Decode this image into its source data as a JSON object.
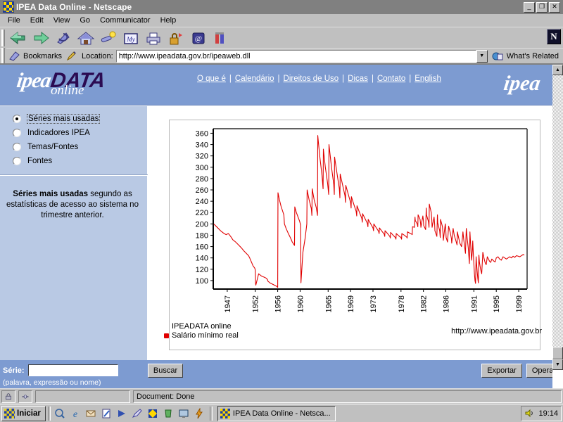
{
  "window": {
    "title": "IPEA Data Online - Netscape",
    "icon": "netscape-icon",
    "minimize_label": "_",
    "restore_label": "❐",
    "close_label": "✕"
  },
  "menubar": {
    "items": [
      {
        "label": "File"
      },
      {
        "label": "Edit"
      },
      {
        "label": "View"
      },
      {
        "label": "Go"
      },
      {
        "label": "Communicator"
      },
      {
        "label": "Help"
      }
    ]
  },
  "toolbar": {
    "buttons": [
      {
        "name": "back-icon",
        "glyph": "◀"
      },
      {
        "name": "forward-icon",
        "glyph": "▶"
      },
      {
        "name": "reload-icon",
        "glyph": "↻"
      },
      {
        "name": "home-icon",
        "glyph": "⌂"
      },
      {
        "name": "search-icon",
        "glyph": "⚲"
      },
      {
        "name": "my-netscape-icon",
        "glyph": "My"
      },
      {
        "name": "print-icon",
        "glyph": "⎙"
      },
      {
        "name": "security-icon",
        "glyph": "⚿"
      },
      {
        "name": "shop-icon",
        "glyph": "@"
      },
      {
        "name": "stop-icon",
        "glyph": "⬚"
      }
    ]
  },
  "locationbar": {
    "bookmarks_label": "Bookmarks",
    "location_label": "Location:",
    "url": "http://www.ipeadata.gov.br/ipeaweb.dll",
    "dropdown_glyph": "▼",
    "whats_related_label": "What's Related",
    "netscape_badge": "N"
  },
  "banner": {
    "logo_ipea": "ipea",
    "logo_data": "DATA",
    "logo_online": "online",
    "logo_right": "ipea",
    "nav_links": [
      {
        "label": "O que é"
      },
      {
        "label": "Calendário"
      },
      {
        "label": "Direitos de Uso"
      },
      {
        "label": "Dicas"
      },
      {
        "label": "Contato"
      },
      {
        "label": "English"
      }
    ],
    "nav_separator": "|"
  },
  "sidebar": {
    "options": [
      {
        "label": "Séries mais usadas",
        "selected": true
      },
      {
        "label": "Indicadores IPEA",
        "selected": false
      },
      {
        "label": "Temas/Fontes",
        "selected": false
      },
      {
        "label": "Fontes",
        "selected": false
      }
    ],
    "description_bold": "Séries mais usadas",
    "description_rest": " segundo as estatísticas de acesso ao sistema no trimestre anterior."
  },
  "chart_legend": {
    "source": "IPEADATA online",
    "series_label": "Salário mínimo real",
    "url": "http://www.ipeadata.gov.br"
  },
  "form": {
    "serie_label": "Série:",
    "serie_value": "",
    "serie_placeholder": "",
    "serie_hint": "(palavra, expressão ou nome)",
    "buscar_label": "Buscar",
    "exportar_label": "Exportar",
    "operar_label": "Operar"
  },
  "scrollbar": {
    "up_glyph": "▲",
    "down_glyph": "▼"
  },
  "statusbar": {
    "security_icon": "⚿",
    "connection_icon": "⧉",
    "status_text": "Document: Done"
  },
  "taskbar": {
    "start_label": "Iniciar",
    "quick_icons": [
      {
        "name": "show-desktop-icon",
        "glyph": "Ὕ4"
      },
      {
        "name": "internet-explorer-icon",
        "glyph": "e"
      },
      {
        "name": "mail-icon",
        "glyph": "✉"
      },
      {
        "name": "notepad-icon",
        "glyph": "✎"
      },
      {
        "name": "winamp-icon",
        "glyph": "▶"
      },
      {
        "name": "paint-icon",
        "glyph": "✏"
      },
      {
        "name": "netscape-quick-icon",
        "glyph": "✦"
      },
      {
        "name": "recycle-icon",
        "glyph": "♻"
      },
      {
        "name": "monitor-icon",
        "glyph": "▣"
      },
      {
        "name": "flash-icon",
        "glyph": "⚡"
      }
    ],
    "task_title": "IPEA Data Online - Netsca...",
    "tray_volume_icon": "ὐA",
    "clock": "19:14"
  },
  "colors": {
    "banner_blue": "#7d9bd1",
    "sidebar_blue": "#b9c9e4",
    "series_red": "#e00000",
    "logo_purple": "#2b0b52",
    "chrome_gray": "#c0c0c0",
    "titlebar_gray": "#808080"
  },
  "chart_data": {
    "type": "line",
    "title": "",
    "xlabel": "",
    "ylabel": "",
    "series_name": "Salário mínimo real",
    "color": "#e00000",
    "grid": false,
    "legend_position": "bottom-left",
    "xlim": [
      1944.5,
      2000.5
    ],
    "ylim": [
      85,
      368
    ],
    "ytick_values": [
      100,
      120,
      140,
      160,
      180,
      200,
      220,
      240,
      260,
      280,
      300,
      320,
      340,
      360
    ],
    "xtick_labels": [
      "1947",
      "1952",
      "1956",
      "1960",
      "1965",
      "1969",
      "1973",
      "1978",
      "1982",
      "1986",
      "1991",
      "1995",
      "1999"
    ],
    "xtick_values": [
      1947,
      1952,
      1956,
      1960,
      1965,
      1969,
      1973,
      1978,
      1982,
      1986,
      1991,
      1995,
      1999
    ],
    "x": [
      1944.6,
      1945.2,
      1945.8,
      1946.3,
      1946.8,
      1947.2,
      1947.6,
      1948.0,
      1948.5,
      1949.0,
      1949.5,
      1950.0,
      1950.4,
      1950.8,
      1951.0,
      1951.3,
      1951.6,
      1951.9,
      1952.0,
      1952.05,
      1952.1,
      1952.6,
      1953.1,
      1953.6,
      1954.0,
      1954.2,
      1954.25,
      1954.6,
      1955.0,
      1955.4,
      1955.8,
      1956.0,
      1956.05,
      1956.3,
      1956.6,
      1956.9,
      1957.1,
      1957.2,
      1957.5,
      1957.9,
      1958.3,
      1958.6,
      1959.0,
      1959.05,
      1959.3,
      1959.6,
      1959.9,
      1960.1,
      1960.15,
      1960.5,
      1960.9,
      1961.2,
      1961.25,
      1961.6,
      1962.0,
      1962.1,
      1962.15,
      1962.5,
      1962.9,
      1963.1,
      1963.15,
      1963.5,
      1963.9,
      1964.1,
      1964.15,
      1964.5,
      1964.9,
      1965.1,
      1965.15,
      1965.6,
      1966.0,
      1966.1,
      1966.15,
      1966.6,
      1967.0,
      1967.1,
      1967.15,
      1967.6,
      1968.0,
      1968.1,
      1968.15,
      1968.6,
      1969.0,
      1969.1,
      1969.15,
      1969.6,
      1970.0,
      1970.1,
      1970.15,
      1970.6,
      1971.0,
      1971.1,
      1971.15,
      1971.6,
      1972.0,
      1972.1,
      1972.15,
      1972.6,
      1973.0,
      1973.1,
      1973.15,
      1973.6,
      1974.0,
      1974.1,
      1974.15,
      1974.6,
      1975.0,
      1975.1,
      1975.15,
      1975.6,
      1976.0,
      1976.1,
      1976.15,
      1976.6,
      1977.0,
      1977.1,
      1977.15,
      1977.6,
      1978.0,
      1978.1,
      1978.15,
      1978.6,
      1979.0,
      1979.1,
      1979.15,
      1979.5,
      1979.9,
      1980.0,
      1980.05,
      1980.4,
      1980.5,
      1980.55,
      1980.9,
      1981.0,
      1981.05,
      1981.4,
      1981.5,
      1981.55,
      1981.9,
      1982.0,
      1982.05,
      1982.4,
      1982.5,
      1982.55,
      1982.9,
      1983.0,
      1983.05,
      1983.4,
      1983.5,
      1983.55,
      1983.9,
      1984.0,
      1984.05,
      1984.4,
      1984.5,
      1984.55,
      1984.9,
      1985.0,
      1985.05,
      1985.4,
      1985.5,
      1985.55,
      1985.9,
      1986.0,
      1986.05,
      1986.3,
      1986.5,
      1986.8,
      1987.0,
      1987.05,
      1987.3,
      1987.5,
      1987.8,
      1988.0,
      1988.05,
      1988.3,
      1988.5,
      1988.8,
      1989.0,
      1989.05,
      1989.2,
      1989.35,
      1989.5,
      1989.65,
      1989.8,
      1990.0,
      1990.1,
      1990.2,
      1990.3,
      1990.4,
      1990.5,
      1990.6,
      1990.7,
      1990.8,
      1990.9,
      1991.0,
      1991.1,
      1991.2,
      1991.3,
      1991.4,
      1991.5,
      1991.6,
      1991.7,
      1991.8,
      1991.9,
      1992.0,
      1992.2,
      1992.4,
      1992.6,
      1992.8,
      1993.0,
      1993.2,
      1993.4,
      1993.6,
      1993.8,
      1994.0,
      1994.2,
      1994.4,
      1994.6,
      1994.8,
      1995.0,
      1995.3,
      1995.6,
      1995.9,
      1996.2,
      1996.5,
      1996.8,
      1997.1,
      1997.4,
      1997.7,
      1998.0,
      1998.3,
      1998.6,
      1998.9,
      1999.2,
      1999.5,
      1999.8,
      2000.0
    ],
    "y": [
      200,
      194,
      188,
      184,
      181,
      183,
      178,
      172,
      168,
      163,
      158,
      152,
      148,
      144,
      140,
      133,
      126,
      122,
      119,
      95,
      92,
      112,
      108,
      106,
      104,
      101,
      99,
      96,
      94,
      92,
      90,
      88,
      255,
      243,
      231,
      222,
      216,
      200,
      192,
      183,
      175,
      168,
      162,
      230,
      221,
      213,
      205,
      198,
      96,
      150,
      175,
      200,
      260,
      243,
      227,
      215,
      262,
      243,
      228,
      215,
      356,
      320,
      286,
      262,
      332,
      300,
      272,
      252,
      340,
      300,
      270,
      252,
      318,
      288,
      262,
      246,
      288,
      268,
      250,
      238,
      268,
      252,
      238,
      228,
      248,
      234,
      222,
      214,
      232,
      220,
      210,
      203,
      218,
      209,
      201,
      195,
      208,
      200,
      193,
      188,
      200,
      193,
      187,
      183,
      193,
      187,
      182,
      178,
      188,
      183,
      178,
      175,
      185,
      180,
      176,
      173,
      183,
      179,
      176,
      173,
      183,
      180,
      177,
      175,
      186,
      184,
      182,
      181,
      195,
      194,
      212,
      206,
      200,
      195,
      216,
      208,
      200,
      194,
      214,
      206,
      197,
      190,
      228,
      216,
      204,
      194,
      235,
      220,
      206,
      194,
      212,
      200,
      188,
      178,
      216,
      202,
      188,
      176,
      208,
      195,
      182,
      171,
      200,
      188,
      176,
      168,
      196,
      184,
      174,
      166,
      192,
      180,
      170,
      163,
      186,
      175,
      166,
      160,
      180,
      186,
      172,
      160,
      148,
      192,
      175,
      158,
      144,
      130,
      186,
      168,
      150,
      136,
      148,
      170,
      148,
      130,
      112,
      100,
      95,
      142,
      128,
      115,
      104,
      96,
      145,
      132,
      120,
      112,
      150,
      140,
      132,
      128,
      142,
      138,
      134,
      132,
      138,
      136,
      134,
      133,
      140,
      142,
      138,
      136,
      142,
      140,
      138,
      140,
      142,
      140,
      143,
      141,
      144,
      143,
      142,
      144,
      146,
      145,
      147,
      146,
      148,
      147,
      149,
      148,
      150,
      149,
      151,
      150
    ]
  }
}
